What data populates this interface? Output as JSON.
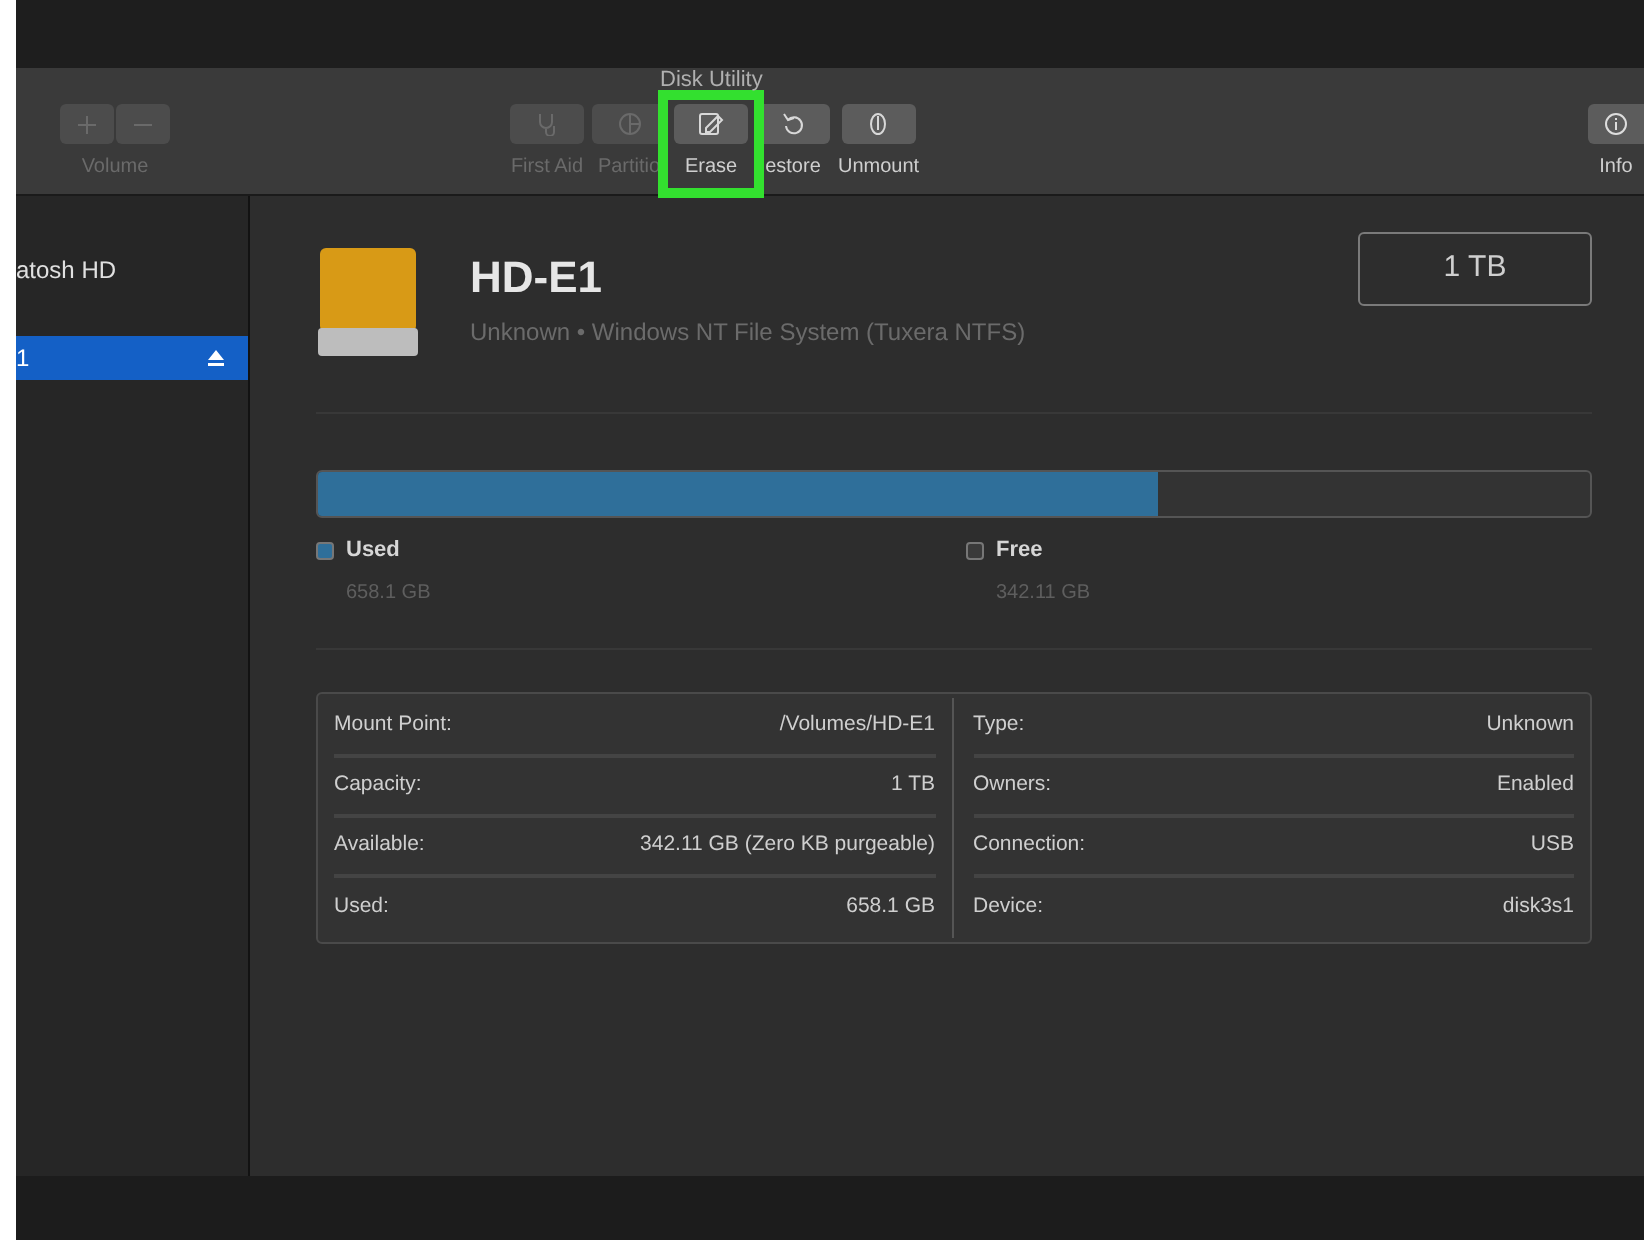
{
  "window": {
    "title": "Disk Utility"
  },
  "toolbar": [
    {
      "kind": "volume",
      "label": "Volume",
      "disabled": true,
      "highlighted": false
    },
    {
      "kind": "firstaid",
      "label": "First Aid",
      "disabled": true,
      "highlighted": false
    },
    {
      "kind": "partition",
      "label": "Partitio",
      "disabled": true,
      "highlighted": false
    },
    {
      "kind": "erase",
      "label": "Erase",
      "disabled": false,
      "highlighted": true
    },
    {
      "kind": "restore",
      "label": "estore",
      "disabled": false,
      "highlighted": false
    },
    {
      "kind": "unmount",
      "label": "Unmount",
      "disabled": false,
      "highlighted": false
    }
  ],
  "info_button": {
    "label": "Info"
  },
  "sidebar": {
    "items": [
      {
        "label": "atosh HD",
        "selected": false,
        "eject": false
      },
      {
        "label": "1",
        "selected": true,
        "eject": true
      }
    ]
  },
  "disk": {
    "name": "HD-E1",
    "description": "Unknown • Windows NT File System (Tuxera NTFS)",
    "size": "1 TB"
  },
  "usage": {
    "level": 0.66,
    "legend": [
      {
        "label": "Used",
        "value": "658.1 GB",
        "color": "#2f6f9a"
      },
      {
        "label": "Free",
        "value": "342.11 GB",
        "color": "#3a3a3a"
      }
    ]
  },
  "details": {
    "left": [
      {
        "label": "Mount Point:",
        "value": "/Volumes/HD-E1"
      },
      {
        "label": "Capacity:",
        "value": "1 TB"
      },
      {
        "label": "Available:",
        "value": "342.11 GB (Zero KB purgeable)"
      },
      {
        "label": "Used:",
        "value": "658.1 GB"
      }
    ],
    "right": [
      {
        "label": "Type:",
        "value": "Unknown"
      },
      {
        "label": "Owners:",
        "value": "Enabled"
      },
      {
        "label": "Connection:",
        "value": "USB"
      },
      {
        "label": "Device:",
        "value": "disk3s1"
      }
    ]
  }
}
